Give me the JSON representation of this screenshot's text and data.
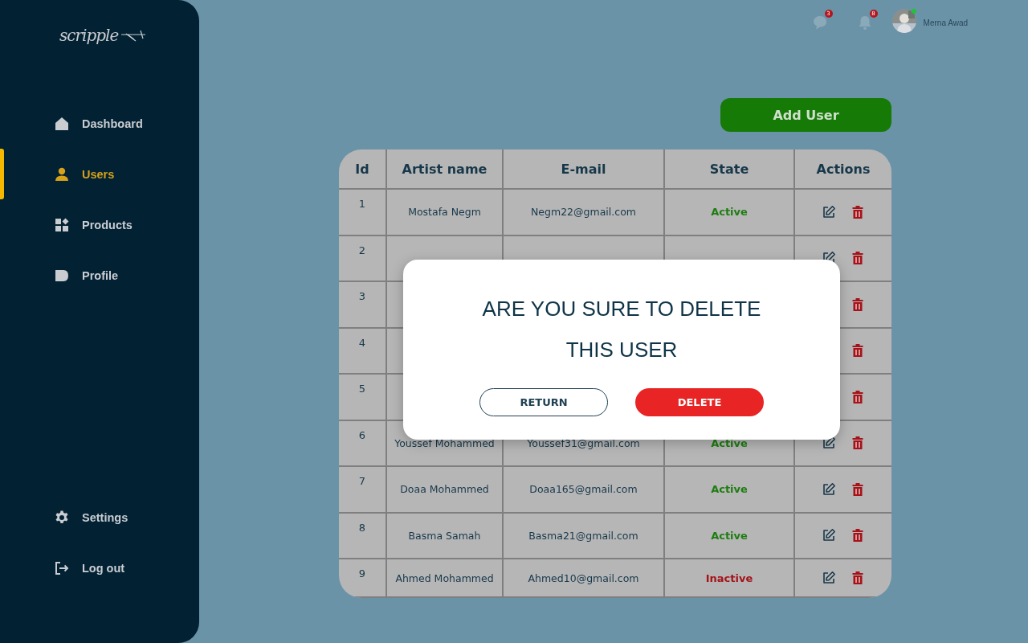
{
  "sidebar": {
    "logo": "scripple",
    "nav_items": [
      {
        "label": "Dashboard",
        "selected": false
      },
      {
        "label": "Users",
        "selected": true
      },
      {
        "label": "Products",
        "selected": false
      },
      {
        "label": "Profile",
        "selected": false
      }
    ],
    "bottom_items": [
      {
        "label": "Settings"
      },
      {
        "label": "Log out"
      }
    ]
  },
  "header": {
    "messages_badge": "3",
    "notifications_badge": "8",
    "user_name": "Merna Awad",
    "online": true
  },
  "add_button": "Add User",
  "table": {
    "columns": [
      "Id",
      "Artist name",
      "E-mail",
      "State",
      "Actions"
    ],
    "rows": [
      {
        "id": "1",
        "artist_name": "Mostafa Negm",
        "email": "Negm22@gmail.com",
        "state": "Active",
        "color": "#1f7d12"
      },
      {
        "id": "2"
      },
      {
        "id": "3"
      },
      {
        "id": "4"
      },
      {
        "id": "5"
      },
      {
        "id": "6",
        "artist_name": "Youssef Mohammed",
        "email": "Youssef31@gmail.com",
        "state": "Active",
        "color": "#1f7d12"
      },
      {
        "id": "7",
        "artist_name": "Doaa Mohammed",
        "email": "Doaa165@gmail.com",
        "state": "Active",
        "color": "#1f7d12"
      },
      {
        "id": "8",
        "artist_name": "Basma Samah",
        "email": "Basma21@gmail.com",
        "state": "Active",
        "color": "#1f7d12"
      },
      {
        "id": "9",
        "artist_name": "Ahmed Mohammed",
        "email": "Ahmed10@gmail.com",
        "state": "Inactive",
        "color": "#a5131a"
      }
    ]
  },
  "modal": {
    "title_lines": [
      "ARE YOU SURE TO DELETE",
      "THIS USER"
    ],
    "buttons": [
      {
        "label": "RETURN",
        "kind": "secondary"
      },
      {
        "label": "DELETE",
        "kind": "danger"
      }
    ]
  }
}
